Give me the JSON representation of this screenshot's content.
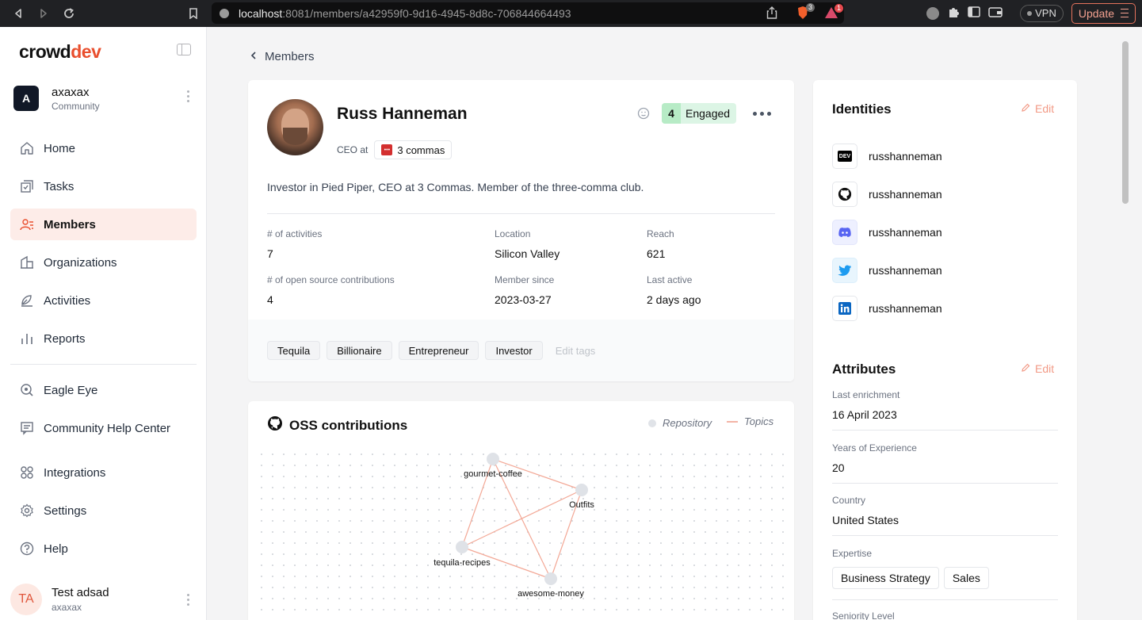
{
  "browser": {
    "url_host": "localhost",
    "url_path": ":8081/members/a42959f0-9d16-4945-8d8c-706844664493",
    "brave_badge": "3",
    "alert_badge": "1",
    "vpn_label": "VPN",
    "update_label": "Update"
  },
  "sidebar": {
    "logo_main": "crowd",
    "logo_accent": "dev",
    "workspace": {
      "initial": "A",
      "name": "axaxax",
      "type": "Community"
    },
    "items": [
      {
        "label": "Home",
        "icon": "home-icon"
      },
      {
        "label": "Tasks",
        "icon": "tasks-icon"
      },
      {
        "label": "Members",
        "icon": "members-icon",
        "active": true
      },
      {
        "label": "Organizations",
        "icon": "organizations-icon"
      },
      {
        "label": "Activities",
        "icon": "activities-icon"
      },
      {
        "label": "Reports",
        "icon": "reports-icon"
      }
    ],
    "secondary": [
      {
        "label": "Eagle Eye",
        "icon": "eagle-eye-icon"
      },
      {
        "label": "Community Help Center",
        "icon": "help-center-icon"
      }
    ],
    "bottom": [
      {
        "label": "Integrations",
        "icon": "integrations-icon"
      },
      {
        "label": "Settings",
        "icon": "settings-icon"
      },
      {
        "label": "Help",
        "icon": "help-icon"
      }
    ],
    "user": {
      "initials": "TA",
      "name": "Test adsad",
      "workspace": "axaxax"
    }
  },
  "breadcrumb": {
    "back_label": "Members"
  },
  "member": {
    "name": "Russ Hanneman",
    "title": "CEO at",
    "organization": "3 commas",
    "engagement_score": "4",
    "engagement_label": "Engaged",
    "bio": "Investor in Pied Piper, CEO at 3 Commas. Member of the three-comma club.",
    "stats": [
      {
        "label": "# of activities",
        "value": "7"
      },
      {
        "label": "Location",
        "value": "Silicon Valley"
      },
      {
        "label": "Reach",
        "value": "621"
      },
      {
        "label": "# of open source contributions",
        "value": "4"
      },
      {
        "label": "Member since",
        "value": "2023-03-27"
      },
      {
        "label": "Last active",
        "value": "2 days ago"
      }
    ],
    "tags": [
      "Tequila",
      "Billionaire",
      "Entrepreneur",
      "Investor"
    ],
    "edit_tags_label": "Edit tags"
  },
  "oss": {
    "title": "OSS contributions",
    "legend_repository": "Repository",
    "legend_topics": "Topics",
    "nodes": [
      "gourmet-coffee",
      "Outfits",
      "tequila-recipes",
      "awesome-money"
    ],
    "colors": {
      "node": "#dfe2e7",
      "edge": "#f3a896"
    }
  },
  "identities": {
    "title": "Identities",
    "edit_label": "Edit",
    "items": [
      {
        "platform": "dev-icon",
        "username": "russhanneman"
      },
      {
        "platform": "github-icon",
        "username": "russhanneman"
      },
      {
        "platform": "discord-icon",
        "username": "russhanneman"
      },
      {
        "platform": "twitter-icon",
        "username": "russhanneman"
      },
      {
        "platform": "linkedin-icon",
        "username": "russhanneman"
      }
    ]
  },
  "attributes": {
    "title": "Attributes",
    "edit_label": "Edit",
    "items": [
      {
        "label": "Last enrichment",
        "value": "16 April 2023"
      },
      {
        "label": "Years of Experience",
        "value": "20"
      },
      {
        "label": "Country",
        "value": "United States"
      }
    ],
    "expertise_label": "Expertise",
    "expertise": [
      "Business Strategy",
      "Sales"
    ],
    "next_label": "Seniority Level"
  },
  "colors": {
    "accent": "#e94f2e",
    "active_bg": "#fdece8",
    "engaged_bg": "#dcf5e5"
  }
}
